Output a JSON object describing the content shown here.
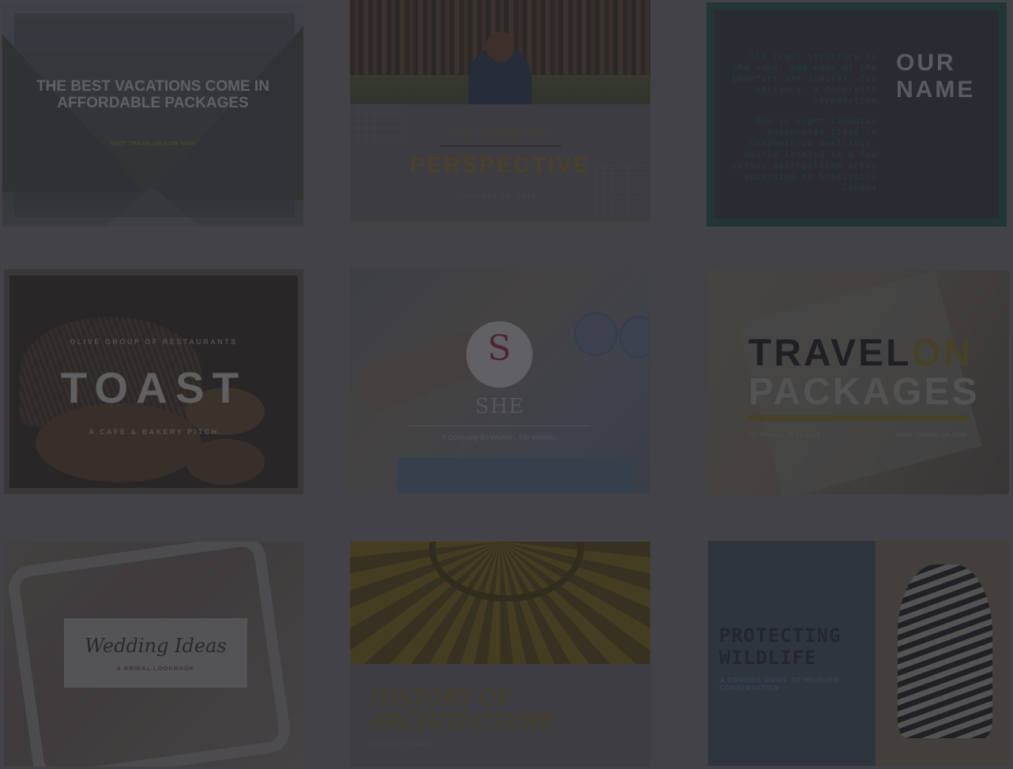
{
  "templates": [
    {
      "id": "c1",
      "title": "THE BEST VACATIONS COME IN AFFORDABLE PACKAGES",
      "cta": "VISIT TRAVELON.COM NOW"
    },
    {
      "id": "c2",
      "kicker": "THE POWER OF",
      "title": "PERSPECTIVE",
      "date": "AUGUST 15, 2016"
    },
    {
      "id": "c3",
      "para1": "The legal structure is the same, and many of the benefits are similar, for instance, a nonprofit corporation",
      "para2": "One in eight Canadian households lived in condominium dwellings, mostly located in a few census metropolitan areas according to Statistics Canada",
      "name_line1": "OUR",
      "name_line2": "NAME"
    },
    {
      "id": "c4",
      "kicker": "OLIVE GROUP OF RESTAURANTS",
      "title": "TOAST",
      "sub": "A CAFE & BAKERY PITCH"
    },
    {
      "id": "c5",
      "logo_letter": "S",
      "title": "SHE",
      "tagline": "A Company By Women, For Women."
    },
    {
      "id": "c6",
      "title_a": "TRAVEL",
      "title_b": "ON",
      "title_line2": "PACKAGES",
      "left_caption": "TO TRAVEL IS TO LIVE",
      "right_caption": "WWW.TRAVELON.COM"
    },
    {
      "id": "c7",
      "title": "Wedding Ideas",
      "sub": "A BRIDAL LOOKBOOK"
    },
    {
      "id": "c8",
      "title_line1": "HISTORY OF",
      "title_line2": "ARCHITECTURE",
      "byline": "By Maggie Williams"
    },
    {
      "id": "c9",
      "title_line1": "PROTECTING",
      "title_line2": "WILDLIFE",
      "sub": "A CONCISE GUIDE TO WILDLIFE CONSERVATION"
    }
  ],
  "colors": {
    "overlay": "#434247",
    "accent_gold": "#6d6322",
    "accent_teal": "#1f4b44"
  }
}
